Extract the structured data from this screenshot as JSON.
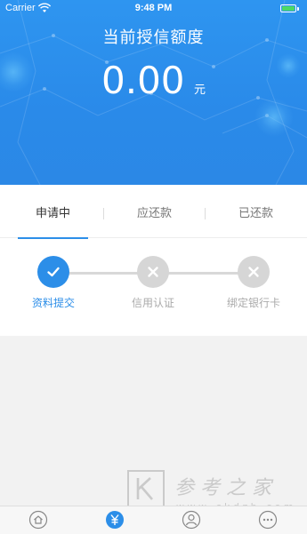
{
  "status_bar": {
    "carrier": "Carrier",
    "time": "9:48 PM"
  },
  "header": {
    "title": "当前授信额度",
    "amount": "0.00",
    "unit": "元"
  },
  "tabs": [
    {
      "label": "申请中",
      "active": true
    },
    {
      "label": "应还款",
      "active": false
    },
    {
      "label": "已还款",
      "active": false
    }
  ],
  "steps": [
    {
      "label": "资料提交",
      "state": "done"
    },
    {
      "label": "信用认证",
      "state": "todo"
    },
    {
      "label": "绑定银行卡",
      "state": "todo"
    }
  ],
  "watermark": {
    "text": "参考之家",
    "url": "www.ckdzb.com"
  },
  "colors": {
    "accent": "#2c8ee8",
    "header_blue": "#2b8be8",
    "inactive_gray": "#d6d6d6"
  },
  "bottom_nav": [
    {
      "icon": "home-icon",
      "active": false
    },
    {
      "icon": "yen-icon",
      "active": true
    },
    {
      "icon": "user-icon",
      "active": false
    },
    {
      "icon": "more-icon",
      "active": false
    }
  ]
}
